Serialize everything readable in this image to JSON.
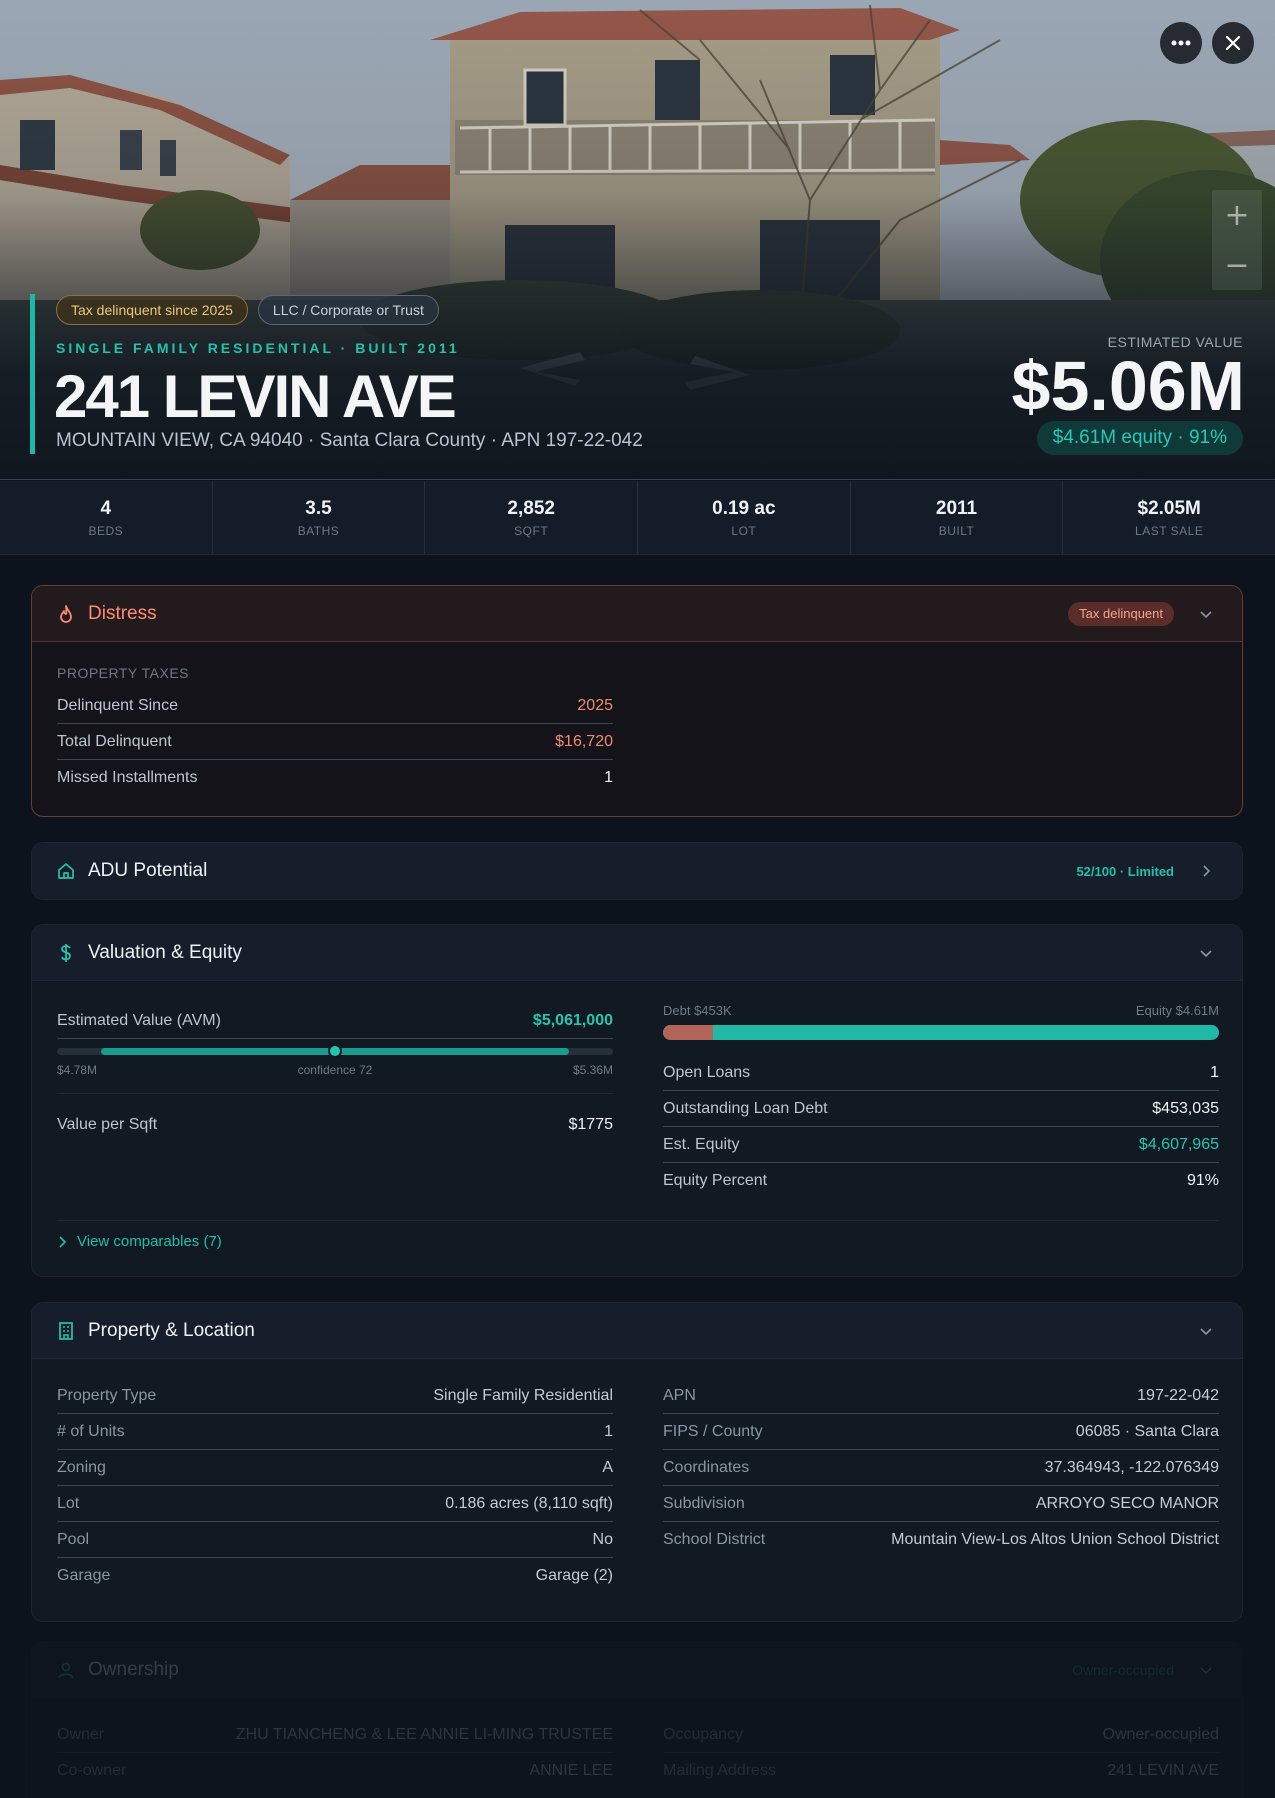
{
  "hero": {
    "tags": {
      "tax": "Tax delinquent since 2025",
      "llc": "LLC / Corporate or Trust"
    },
    "subtitle": "SINGLE FAMILY RESIDENTIAL · BUILT 2011",
    "title": "241 LEVIN AVE",
    "address": "MOUNTAIN VIEW, CA 94040 · Santa Clara County · APN 197-22-042",
    "estimated_label": "ESTIMATED VALUE",
    "estimated_value": "$5.06M",
    "equity_pill": "$4.61M equity · 91%",
    "zoom_in": "+",
    "zoom_out": "−"
  },
  "stats": [
    {
      "value": "4",
      "label": "BEDS"
    },
    {
      "value": "3.5",
      "label": "BATHS"
    },
    {
      "value": "2,852",
      "label": "SQFT"
    },
    {
      "value": "0.19 ac",
      "label": "LOT"
    },
    {
      "value": "2011",
      "label": "BUILT"
    },
    {
      "value": "$2.05M",
      "label": "LAST SALE"
    }
  ],
  "distress": {
    "title": "Distress",
    "badge": "Tax delinquent",
    "section": "PROPERTY TAXES",
    "rows": [
      {
        "label": "Delinquent Since",
        "value": "2025"
      },
      {
        "label": "Total Delinquent",
        "value": "$16,720"
      },
      {
        "label": "Missed Installments",
        "value": "1"
      }
    ]
  },
  "adu": {
    "title": "ADU Potential",
    "score": "52/100 · Limited"
  },
  "valuation": {
    "title": "Valuation & Equity",
    "avm_label": "Estimated Value (AVM)",
    "avm_value": "$5,061,000",
    "range_low": "$4.78M",
    "range_high": "$5.36M",
    "confidence": "confidence 72",
    "confidence_range_fraction": [
      0.08,
      0.92
    ],
    "estimate_fraction": 0.5,
    "per_sqft_label": "Value per Sqft",
    "per_sqft_value": "$1775",
    "debt_label": "Debt $453K",
    "equity_label": "Equity $4.61M",
    "debt_fraction": 0.09,
    "rows": [
      {
        "label": "Open Loans",
        "value": "1"
      },
      {
        "label": "Outstanding Loan Debt",
        "value": "$453,035"
      },
      {
        "label": "Est. Equity",
        "value": "$4,607,965"
      },
      {
        "label": "Equity Percent",
        "value": "91%"
      }
    ],
    "comparables": "View comparables (7)"
  },
  "property": {
    "title": "Property & Location",
    "left": [
      {
        "label": "Property Type",
        "value": "Single Family Residential"
      },
      {
        "label": "# of Units",
        "value": "1"
      },
      {
        "label": "Zoning",
        "value": "A"
      },
      {
        "label": "Lot",
        "value": "0.186 acres (8,110 sqft)"
      },
      {
        "label": "Pool",
        "value": "No"
      },
      {
        "label": "Garage",
        "value": "Garage (2)"
      }
    ],
    "right": [
      {
        "label": "APN",
        "value": "197-22-042"
      },
      {
        "label": "FIPS / County",
        "value": "06085 · Santa Clara"
      },
      {
        "label": "Coordinates",
        "value": "37.364943, -122.076349"
      },
      {
        "label": "Subdivision",
        "value": "ARROYO SECO MANOR"
      },
      {
        "label": "School District",
        "value": "Mountain View-Los Altos Union School District"
      }
    ]
  },
  "ownership": {
    "title": "Ownership",
    "badge": "Owner-occupied",
    "left": [
      {
        "label": "Owner",
        "value": "ZHU TIANCHENG & LEE ANNIE LI-MING TRUSTEE"
      },
      {
        "label": "Co-owner",
        "value": "ANNIE LEE"
      }
    ],
    "right": [
      {
        "label": "Occupancy",
        "value": "Owner-occupied"
      },
      {
        "label": "Mailing Address",
        "value": "241 LEVIN AVE"
      }
    ]
  },
  "colors": {
    "accent": "#1ab8a6",
    "distress": "#ff8a73",
    "background": "#0d131c"
  }
}
